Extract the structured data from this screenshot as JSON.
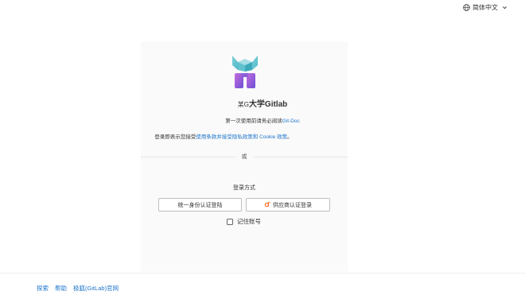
{
  "header": {
    "language_label": "简体中文",
    "globe_icon": "globe-icon",
    "chevron_icon": "chevron-down-icon"
  },
  "brand": {
    "logo_icon": "gitlab-university-logo",
    "title_prefix": "某G",
    "title_main": "大学Gitlab"
  },
  "notice": {
    "text": "第一次使用前请务必阅读",
    "link_text": "Git-Doc"
  },
  "terms": {
    "prefix": "登录即表示您接受",
    "link_text": "使用条款并接受隐私政策和 Cookie 政策",
    "suffix": "。"
  },
  "divider": {
    "text": "或"
  },
  "login": {
    "method_label": "登录方式",
    "unified_auth_button": "统一身份认证登陆",
    "provider_button": "供应商认证登录",
    "provider_icon": "provider-logo-icon",
    "remember_label": "记住账号",
    "remember_checked": false
  },
  "footer": {
    "links": [
      "探索",
      "帮助",
      "极狐(GitLab)官网"
    ]
  },
  "colors": {
    "link": "#1f75cb",
    "provider_icon": "#fc6d26"
  }
}
